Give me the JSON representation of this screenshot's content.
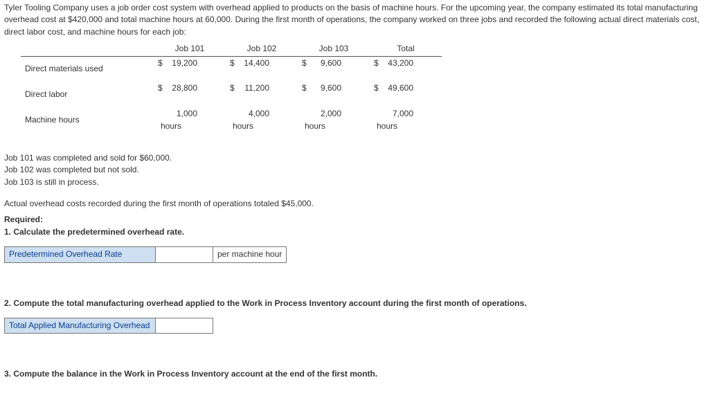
{
  "intro": "Tyler Tooling Company uses a job order cost system with overhead applied to products on the basis of machine hours. For the upcoming year, the company estimated its total manufacturing overhead cost at $420,000 and total machine hours at 60,000. During the first month of operations, the company worked on three jobs and recorded the following actual direct materials cost, direct labor cost, and machine hours for each job:",
  "table": {
    "cols": [
      "Job 101",
      "Job 102",
      "Job 103",
      "Total"
    ],
    "rows": [
      {
        "label": "Direct materials used",
        "cur": "$",
        "vals": [
          "19,200",
          "14,400",
          "9,600",
          "43,200"
        ],
        "unit": ""
      },
      {
        "label": "Direct labor",
        "cur": "$",
        "vals": [
          "28,800",
          "11,200",
          "9,600",
          "49,600"
        ],
        "unit": ""
      },
      {
        "label": "Machine hours",
        "cur": "",
        "vals": [
          "1,000",
          "4,000",
          "2,000",
          "7,000"
        ],
        "unit": "hours"
      }
    ]
  },
  "status1": "Job 101 was completed and sold for $60,000.",
  "status2": "Job 102 was completed but not sold.",
  "status3": "Job 103 is still in process.",
  "ohActual": "Actual overhead costs recorded during the first month of operations totaled $45,000.",
  "required": "Required:",
  "q1": "1. Calculate the predetermined overhead rate.",
  "a1": {
    "label": "Predetermined Overhead Rate",
    "value": "",
    "suffix": "per machine hour"
  },
  "q2": "2. Compute the total manufacturing overhead applied to the Work in Process Inventory account during the first month of operations.",
  "a2": {
    "label": "Total Applied Manufacturing Overhead",
    "value": ""
  },
  "q3": "3. Compute the balance in the Work in Process Inventory account at the end of the first month.",
  "chart_data": {
    "type": "table",
    "categories": [
      "Job 101",
      "Job 102",
      "Job 103",
      "Total"
    ],
    "series": [
      {
        "name": "Direct materials used",
        "values": [
          19200,
          14400,
          9600,
          43200
        ]
      },
      {
        "name": "Direct labor",
        "values": [
          28800,
          11200,
          9600,
          49600
        ]
      },
      {
        "name": "Machine hours",
        "values": [
          1000,
          4000,
          2000,
          7000
        ]
      }
    ],
    "title": "",
    "xlabel": "",
    "ylabel": ""
  }
}
